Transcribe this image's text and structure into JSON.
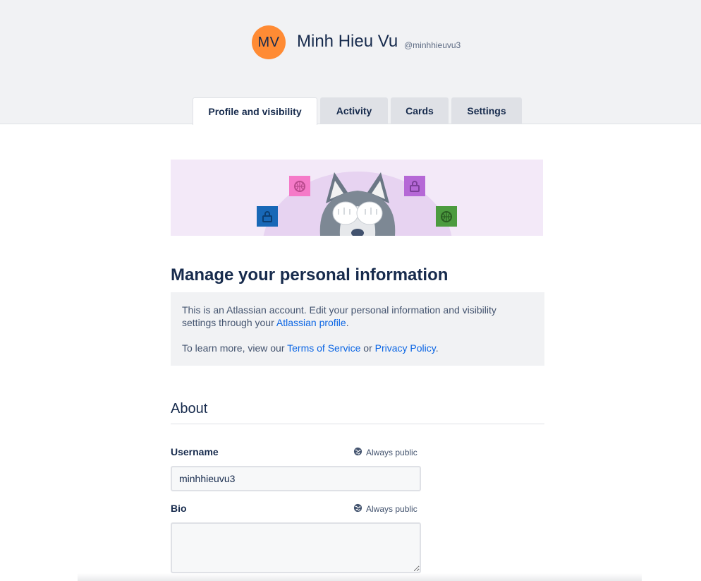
{
  "profile": {
    "initials": "MV",
    "avatar_color": "#ff8b34",
    "full_name": "Minh Hieu Vu",
    "handle": "@minhhieuvu3"
  },
  "tabs": [
    {
      "label": "Profile and visibility",
      "active": true
    },
    {
      "label": "Activity",
      "active": false
    },
    {
      "label": "Cards",
      "active": false
    },
    {
      "label": "Settings",
      "active": false
    }
  ],
  "banner": {
    "illustration": "husky-covering-eyes-with-floating-icons",
    "icons": [
      "lock-icon",
      "basketball-icon",
      "lock-icon",
      "basketball-icon"
    ]
  },
  "main": {
    "heading": "Manage your personal information",
    "info": {
      "line1_text": "This is an Atlassian account. Edit your personal information and visibility settings through your ",
      "line1_link": "Atlassian profile",
      "line1_end": ".",
      "line2_text": "To learn more, view our ",
      "terms_link": "Terms of Service",
      "or_text": " or ",
      "privacy_link": "Privacy Policy",
      "line2_end": "."
    }
  },
  "about": {
    "title": "About",
    "username": {
      "label": "Username",
      "visibility": "Always public",
      "value": "minhhieuvu3"
    },
    "bio": {
      "label": "Bio",
      "visibility": "Always public",
      "value": ""
    }
  },
  "colors": {
    "header_bg": "#f1f2f4",
    "link": "#0c66e4",
    "banner_bg": "#f3e9f8"
  }
}
